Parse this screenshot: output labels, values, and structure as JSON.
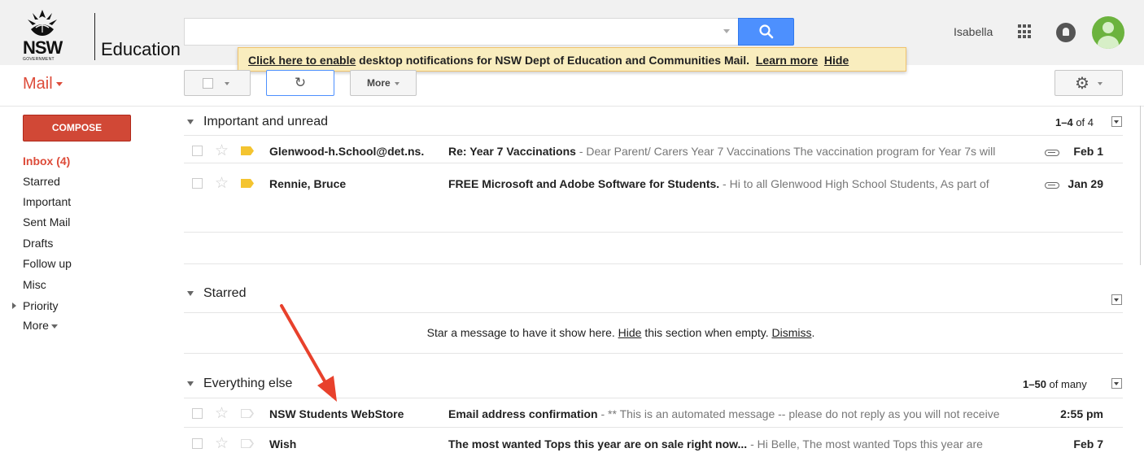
{
  "brand": {
    "logo_primary": "NSW",
    "logo_secondary": "GOVERNMENT",
    "logo_product": "Education"
  },
  "header": {
    "user_name": "Isabella"
  },
  "notification": {
    "enable_link": "Click here to enable",
    "message": " desktop notifications for NSW Dept of Education and Communities Mail.",
    "learn_more": "Learn more",
    "hide": "Hide"
  },
  "toolbar": {
    "mail_label": "Mail",
    "refresh_glyph": "↻",
    "more_label": "More",
    "settings_glyph": "⚙"
  },
  "sidebar": {
    "compose_label": "COMPOSE",
    "items": [
      {
        "label": "Inbox (4)"
      },
      {
        "label": "Starred"
      },
      {
        "label": "Important"
      },
      {
        "label": "Sent Mail"
      },
      {
        "label": "Drafts"
      },
      {
        "label": "Follow up"
      },
      {
        "label": "Misc"
      },
      {
        "label": "Priority"
      },
      {
        "label": "More"
      }
    ]
  },
  "sections": {
    "important": {
      "title": "Important and unread",
      "count_range": "1–4",
      "count_suffix": " of 4",
      "rows": [
        {
          "sender": "Glenwood-h.School@det.ns.",
          "subject": "Re: Year 7 Vaccinations",
          "snippet": " - Dear Parent/ Carers Year 7 Vaccinations The vaccination program for Year 7s will",
          "date": "Feb 1",
          "important": true,
          "attachment": true
        },
        {
          "sender": "Rennie, Bruce",
          "subject": "FREE Microsoft and Adobe Software for Students.",
          "snippet": " - Hi to all Glenwood High School Students, As part of",
          "date": "Jan 29",
          "important": true,
          "attachment": true
        }
      ]
    },
    "starred": {
      "title": "Starred",
      "empty_prefix": "Star a message to have it show here. ",
      "empty_hide": "Hide",
      "empty_middle": " this section when empty. ",
      "empty_dismiss": "Dismiss",
      "empty_suffix": "."
    },
    "everything": {
      "title": "Everything else",
      "count_range": "1–50",
      "count_suffix": " of many",
      "rows": [
        {
          "sender": "NSW Students WebStore",
          "subject": "Email address confirmation",
          "snippet": " - ** This is an automated message -- please do not reply as you will not receive",
          "date": "2:55 pm",
          "important": false,
          "attachment": false
        },
        {
          "sender": "Wish",
          "subject": "The most wanted Tops this year are on sale right now...",
          "snippet": " - Hi Belle, The most wanted Tops this year are",
          "date": "Feb 7",
          "important": false,
          "attachment": false
        }
      ]
    }
  },
  "colors": {
    "accent_red": "#dd4b39",
    "compose_red": "#d14836",
    "search_blue": "#4d90fe",
    "notification_bg": "#f9edbe",
    "importance_yellow": "#f4c430",
    "annotation_arrow": "#e8412c"
  }
}
